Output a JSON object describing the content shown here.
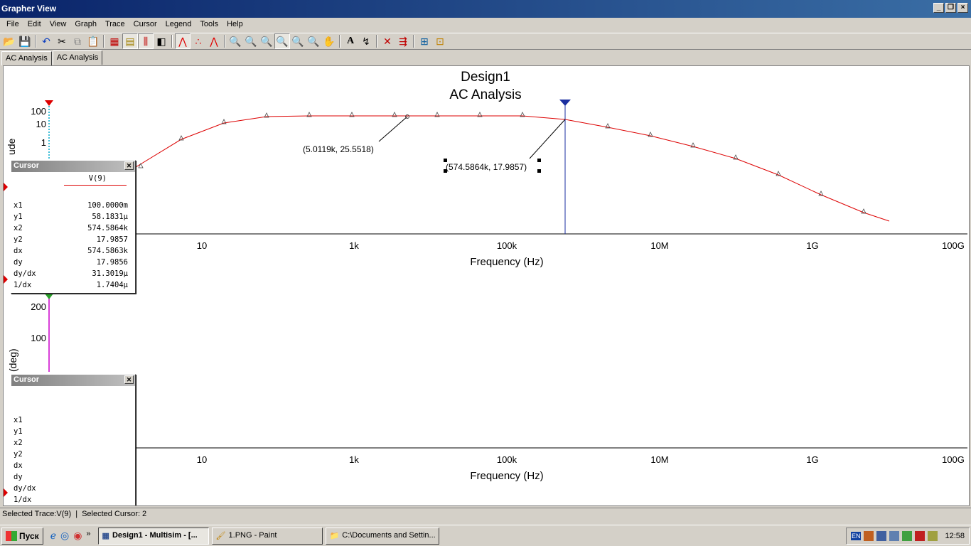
{
  "window": {
    "title": "Grapher View"
  },
  "menu": [
    "File",
    "Edit",
    "View",
    "Graph",
    "Trace",
    "Cursor",
    "Legend",
    "Tools",
    "Help"
  ],
  "tabs": [
    "AC Analysis",
    "AC Analysis"
  ],
  "graph": {
    "title1": "Design1",
    "title2": "AC Analysis",
    "xlabel": "Frequency (Hz)",
    "x_ticks": [
      "10",
      "1k",
      "100k",
      "10M",
      "1G",
      "100G"
    ],
    "mag_y_ticks": [
      "100",
      "10",
      "1"
    ],
    "phase_y_ticks": [
      "200",
      "100"
    ],
    "mag_ylabel_fragment": "ude",
    "phase_ylabel": "(deg)",
    "annotation1": "(5.0119k, 25.5518)",
    "annotation2": "(574.5864k, 17.9857)",
    "trace_color": "#dd0000",
    "cursor_color": "#1a2ea0",
    "phase_axis_color": "#cc00cc",
    "mag_axis_color": "#00aacc"
  },
  "cursor_panel1": {
    "title": "Cursor",
    "trace_name": "V(9)",
    "rows": [
      {
        "label": "x1",
        "value": "100.0000m"
      },
      {
        "label": "y1",
        "value": "58.1831µ"
      },
      {
        "label": "x2",
        "value": "574.5864k"
      },
      {
        "label": "y2",
        "value": "17.9857"
      },
      {
        "label": "dx",
        "value": "574.5863k"
      },
      {
        "label": "dy",
        "value": "17.9856"
      },
      {
        "label": "dy/dx",
        "value": "31.3019µ"
      },
      {
        "label": "1/dx",
        "value": "1.7404µ"
      }
    ]
  },
  "cursor_panel2": {
    "title": "Cursor",
    "rows": [
      "x1",
      "y1",
      "x2",
      "y2",
      "dx",
      "dy",
      "dy/dx",
      "1/dx"
    ]
  },
  "status": {
    "trace": "Selected Trace:V(9)",
    "sep": "|",
    "cursor": "Selected Cursor: 2"
  },
  "taskbar": {
    "start": "Пуск",
    "tasks": [
      {
        "label": "Design1 - Multisim - [..."
      },
      {
        "label": "1.PNG - Paint"
      },
      {
        "label": "C:\\Documents and Settin..."
      }
    ],
    "lang": "EN",
    "clock": "12:58"
  }
}
